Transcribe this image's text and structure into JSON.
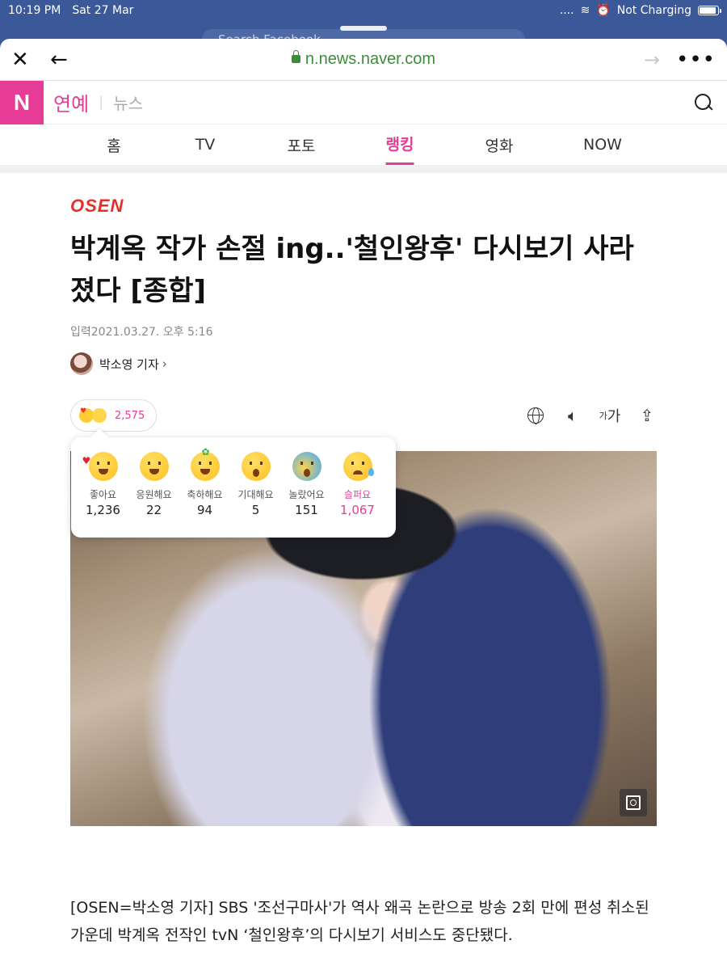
{
  "status": {
    "time": "10:19 PM",
    "date": "Sat 27 Mar",
    "charging": "Not Charging",
    "signal": "....",
    "battery_level": 0.85
  },
  "background": {
    "search_placeholder": "Search Facebook"
  },
  "browser": {
    "url": "n.news.naver.com"
  },
  "brand": {
    "logo": "N",
    "section": "연예",
    "sub": "뉴스"
  },
  "tabs": [
    {
      "label": "홈"
    },
    {
      "label": "TV"
    },
    {
      "label": "포토"
    },
    {
      "label": "랭킹"
    },
    {
      "label": "영화"
    },
    {
      "label": "NOW"
    }
  ],
  "article": {
    "source": "OSEN",
    "title_line1": "박계옥 작가 손절 ing..'철인왕후' 다시보기 사라",
    "title_line2": "졌다 [종합]",
    "date_label": "입력",
    "date": "2021.03.27. 오후 5:16",
    "author": "박소영 기자",
    "reaction_total": "2,575",
    "fontsize_small": "가",
    "fontsize_large": "가",
    "body_line1": "[OSEN=박소영 기자] SBS '조선구마사'가 역사 왜곡 논란으로 방송 2회 만에 편성 취소된",
    "body_line2": "가운데 박계옥 전작인 tvN ‘철인왕후’의 다시보기 서비스도 중단됐다."
  },
  "reactions": [
    {
      "label": "좋아요",
      "count": "1,236"
    },
    {
      "label": "응원해요",
      "count": "22"
    },
    {
      "label": "축하해요",
      "count": "94"
    },
    {
      "label": "기대해요",
      "count": "5"
    },
    {
      "label": "놀랐어요",
      "count": "151"
    },
    {
      "label": "슬퍼요",
      "count": "1,067"
    }
  ]
}
